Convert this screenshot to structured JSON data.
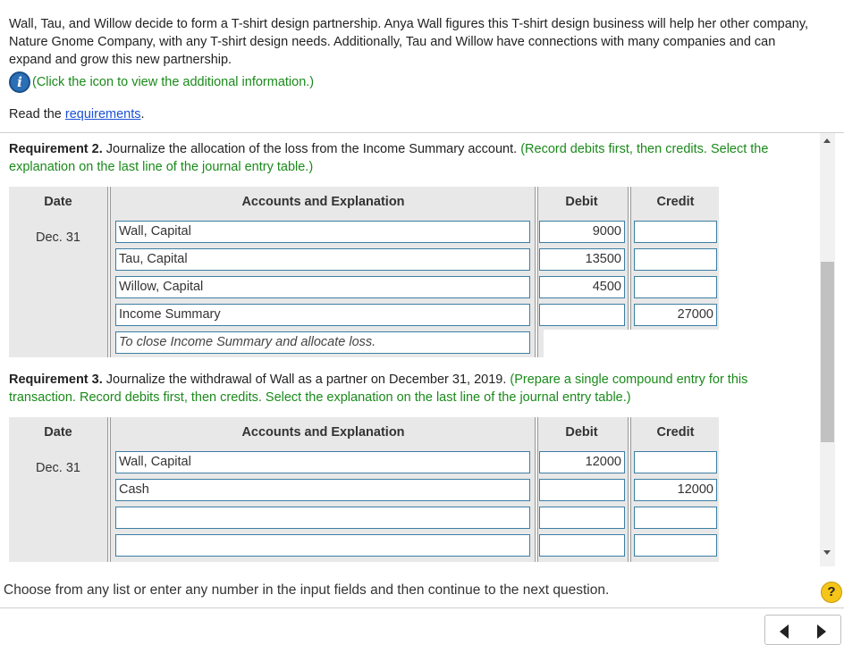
{
  "intro": {
    "text": "Wall, Tau, and Willow decide to form a T-shirt design partnership. Anya Wall figures this T-shirt design business will help her other company, Nature Gnome Company, with any T-shirt design needs. Additionally, Tau and Willow have connections with many companies and can expand and grow this new partnership.",
    "info_text": "(Click the icon to view the additional information.)",
    "info_icon": "info-icon"
  },
  "read": {
    "prefix": "Read the ",
    "link": "requirements",
    "suffix": "."
  },
  "req2": {
    "bold": "Requirement 2.",
    "text": " Journalize the allocation of the loss from the Income Summary account. ",
    "instruction": "(Record debits first, then credits. Select the explanation on the last line of the journal entry table.)"
  },
  "req3": {
    "bold": "Requirement 3.",
    "text": " Journalize the withdrawal of Wall as a partner on December 31, 2019. ",
    "instruction": "(Prepare a single compound entry for this transaction. Record debits first, then credits. Select the explanation on the last line of the journal entry table.)"
  },
  "table_headers": {
    "date": "Date",
    "accounts": "Accounts and Explanation",
    "debit": "Debit",
    "credit": "Credit"
  },
  "journal2": {
    "date": "Dec. 31",
    "rows": [
      {
        "account": "Wall, Capital",
        "debit": "9000",
        "credit": ""
      },
      {
        "account": "Tau, Capital",
        "debit": "13500",
        "credit": ""
      },
      {
        "account": "Willow, Capital",
        "debit": "4500",
        "credit": ""
      },
      {
        "account": "Income Summary",
        "debit": "",
        "credit": "27000"
      }
    ],
    "explanation": "To close Income Summary and allocate loss."
  },
  "journal3": {
    "date": "Dec. 31",
    "rows": [
      {
        "account": "Wall, Capital",
        "debit": "12000",
        "credit": ""
      },
      {
        "account": "Cash",
        "debit": "",
        "credit": "12000"
      },
      {
        "account": "",
        "debit": "",
        "credit": ""
      },
      {
        "account": "",
        "debit": "",
        "credit": ""
      }
    ]
  },
  "footer": {
    "instruction": "Choose from any list or enter any number in the input fields and then continue to the next question.",
    "help_label": "?"
  },
  "colors": {
    "instruction_green": "#1a8a1a",
    "field_border": "#3c7ea3",
    "link_blue": "#1a4fd6",
    "help_yellow": "#f5c518"
  }
}
